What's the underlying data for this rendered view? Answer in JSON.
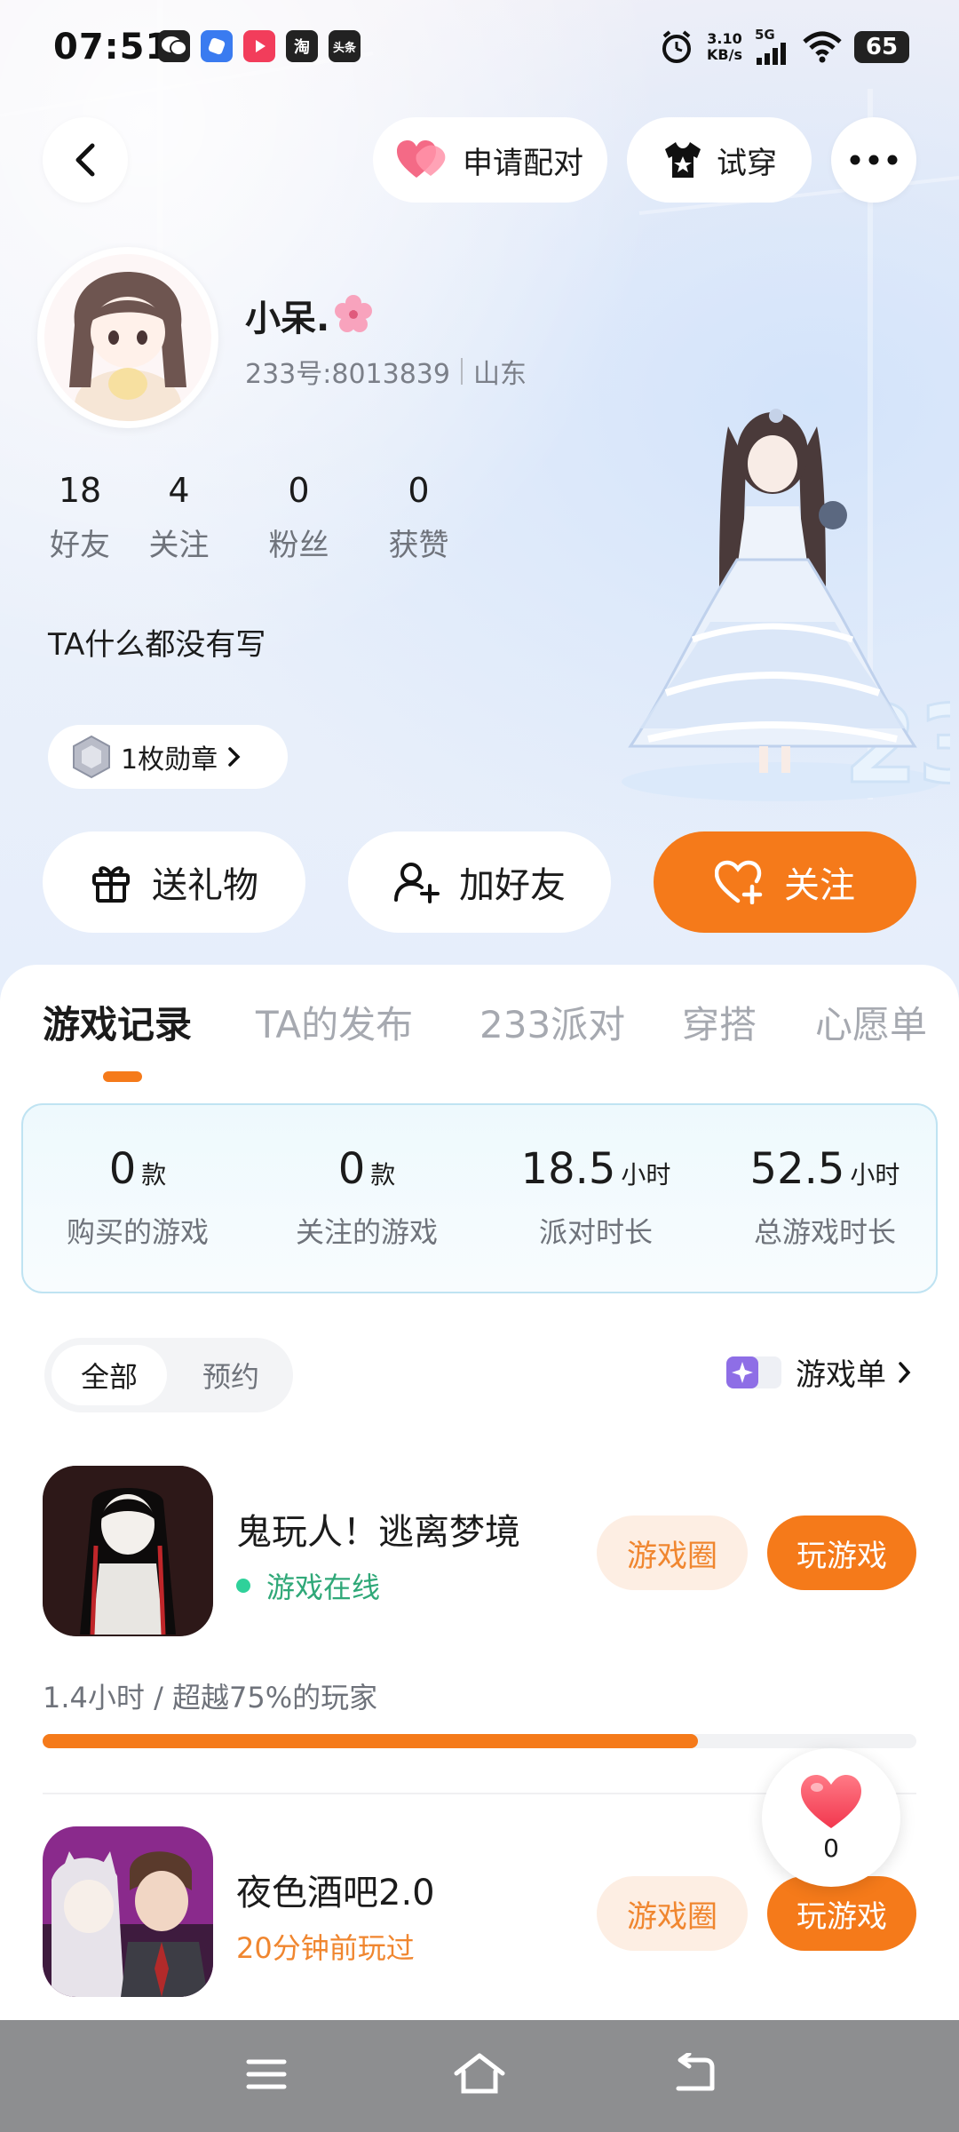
{
  "status_bar": {
    "time": "07:51",
    "apps": [
      "wechat-icon",
      "browser-icon",
      "video-app-icon",
      "taobao-icon",
      "toutiao-icon"
    ],
    "taobao_label": "淘",
    "toutiao_label": "头条",
    "net_speed_value": "3.10",
    "net_speed_unit": "KB/s",
    "network": "5G",
    "battery": "65"
  },
  "top_nav": {
    "pair_label": "申请配对",
    "tryon_label": "试穿"
  },
  "profile": {
    "name": "小呆.",
    "id_text": "233号:8013839",
    "region": "山东",
    "bio": "TA什么都没有写",
    "medal_label": "1枚勋章"
  },
  "stats": [
    {
      "value": "18",
      "label": "好友"
    },
    {
      "value": "4",
      "label": "关注"
    },
    {
      "value": "0",
      "label": "粉丝"
    },
    {
      "value": "0",
      "label": "获赞"
    }
  ],
  "actions": {
    "gift_label": "送礼物",
    "add_friend_label": "加好友",
    "follow_label": "关注"
  },
  "tabs": [
    "游戏记录",
    "TA的发布",
    "233派对",
    "穿搭",
    "心愿单"
  ],
  "active_tab": 0,
  "summary": [
    {
      "value": "0",
      "unit": "款",
      "label": "购买的游戏"
    },
    {
      "value": "0",
      "unit": "款",
      "label": "关注的游戏"
    },
    {
      "value": "18.5",
      "unit": "小时",
      "label": "派对时长"
    },
    {
      "value": "52.5",
      "unit": "小时",
      "label": "总游戏时长"
    }
  ],
  "filter": {
    "all": "全部",
    "reserve": "预约"
  },
  "game_list_link": "游戏单",
  "games": [
    {
      "name": "鬼玩人！逃离梦境",
      "status": "游戏在线",
      "circle_label": "游戏圈",
      "play_label": "玩游戏"
    },
    {
      "name": "夜色酒吧2.0",
      "status": "20分钟前玩过",
      "circle_label": "游戏圈",
      "play_label": "玩游戏"
    }
  ],
  "playtime_text": "1.4小时 / 超越75%的玩家",
  "playtime_progress": 0.75,
  "like_count": "0",
  "colors": {
    "accent": "#f57a1a",
    "online": "#2fd19a",
    "recent": "#f0862f"
  }
}
